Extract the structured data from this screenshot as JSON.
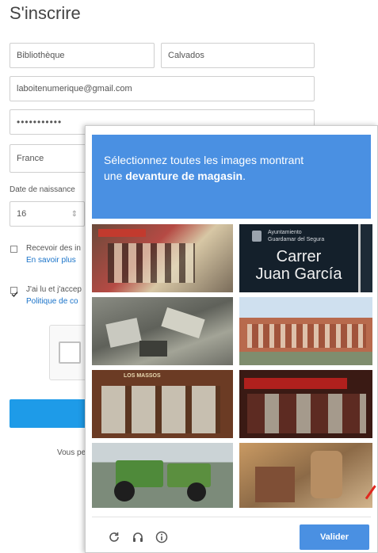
{
  "page": {
    "title": "S'inscrire"
  },
  "form": {
    "first_name": "Bibliothèque",
    "last_name": "Calvados",
    "email": "laboitenumerique@gmail.com",
    "password_mask": "•••••••••••",
    "country": "France",
    "birth_label": "Date de naissance",
    "birth_day": "16",
    "stepper_icon": "⇕",
    "newsletter_label": "Recevoir des in",
    "newsletter_link": "En savoir plus",
    "terms_label": "J'ai lu et j'accep",
    "terms_link": "Politique de co",
    "footer_text": "Vous pe"
  },
  "captcha": {
    "instruction_prefix": "Sélectionnez toutes les images montrant",
    "instruction_bold": "devanture de magasin",
    "instruction_article": "une",
    "instruction_suffix": ".",
    "sign_small_1": "Ayuntamiento",
    "sign_small_2": "Guardamar del Segura",
    "sign_line1": "Carrer",
    "sign_line2": "Juan García",
    "shop_sign": "LOS MASSOS",
    "verify_button": "Valider",
    "icons": [
      "reload-icon",
      "audio-icon",
      "info-icon"
    ]
  },
  "colors": {
    "accent": "#4a90e2",
    "link": "#1a73c9",
    "primary_button": "#1e9be8"
  }
}
